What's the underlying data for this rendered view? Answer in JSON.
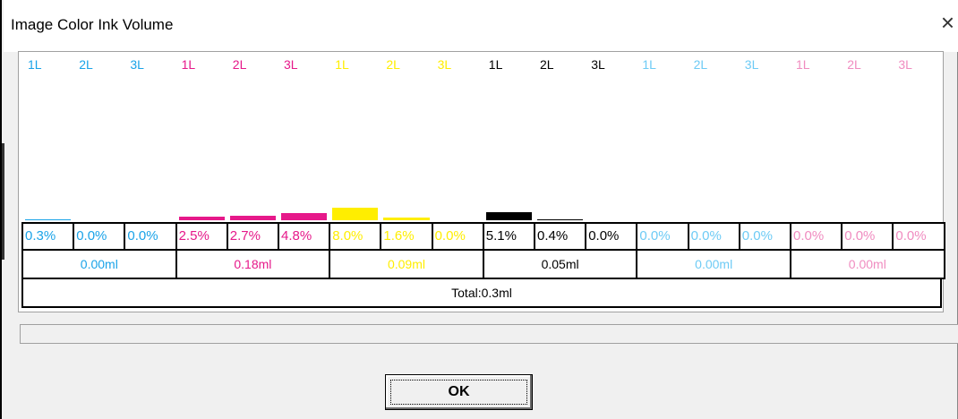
{
  "window": {
    "title": "Image Color Ink Volume",
    "close_glyph": "×"
  },
  "colors": {
    "cyan": "#1aa3e8",
    "magenta": "#e6198a",
    "yellow": "#ffee00",
    "black": "#000000",
    "light_cyan": "#6ecbf5",
    "light_magenta": "#f08cc0"
  },
  "channels": [
    {
      "color": "cyan",
      "layers": [
        {
          "label": "1L",
          "pct": "0.3%",
          "level": 0.3
        },
        {
          "label": "2L",
          "pct": "0.0%",
          "level": 0.0
        },
        {
          "label": "3L",
          "pct": "0.0%",
          "level": 0.0
        }
      ],
      "ml": "0.00ml"
    },
    {
      "color": "magenta",
      "layers": [
        {
          "label": "1L",
          "pct": "2.5%",
          "level": 2.5
        },
        {
          "label": "2L",
          "pct": "2.7%",
          "level": 2.7
        },
        {
          "label": "3L",
          "pct": "4.8%",
          "level": 4.8
        }
      ],
      "ml": "0.18ml"
    },
    {
      "color": "yellow",
      "layers": [
        {
          "label": "1L",
          "pct": "8.0%",
          "level": 8.0
        },
        {
          "label": "2L",
          "pct": "1.6%",
          "level": 1.6
        },
        {
          "label": "3L",
          "pct": "0.0%",
          "level": 0.0
        }
      ],
      "ml": "0.09ml"
    },
    {
      "color": "black",
      "layers": [
        {
          "label": "1L",
          "pct": "5.1%",
          "level": 5.1
        },
        {
          "label": "2L",
          "pct": "0.4%",
          "level": 0.4
        },
        {
          "label": "3L",
          "pct": "0.0%",
          "level": 0.0
        }
      ],
      "ml": "0.05ml"
    },
    {
      "color": "light_cyan",
      "layers": [
        {
          "label": "1L",
          "pct": "0.0%",
          "level": 0.0
        },
        {
          "label": "2L",
          "pct": "0.0%",
          "level": 0.0
        },
        {
          "label": "3L",
          "pct": "0.0%",
          "level": 0.0
        }
      ],
      "ml": "0.00ml"
    },
    {
      "color": "light_magenta",
      "layers": [
        {
          "label": "1L",
          "pct": "0.0%",
          "level": 0.0
        },
        {
          "label": "2L",
          "pct": "0.0%",
          "level": 0.0
        },
        {
          "label": "3L",
          "pct": "0.0%",
          "level": 0.0
        }
      ],
      "ml": "0.00ml"
    }
  ],
  "total": "Total:0.3ml",
  "progress": 0,
  "buttons": {
    "ok": "OK"
  }
}
